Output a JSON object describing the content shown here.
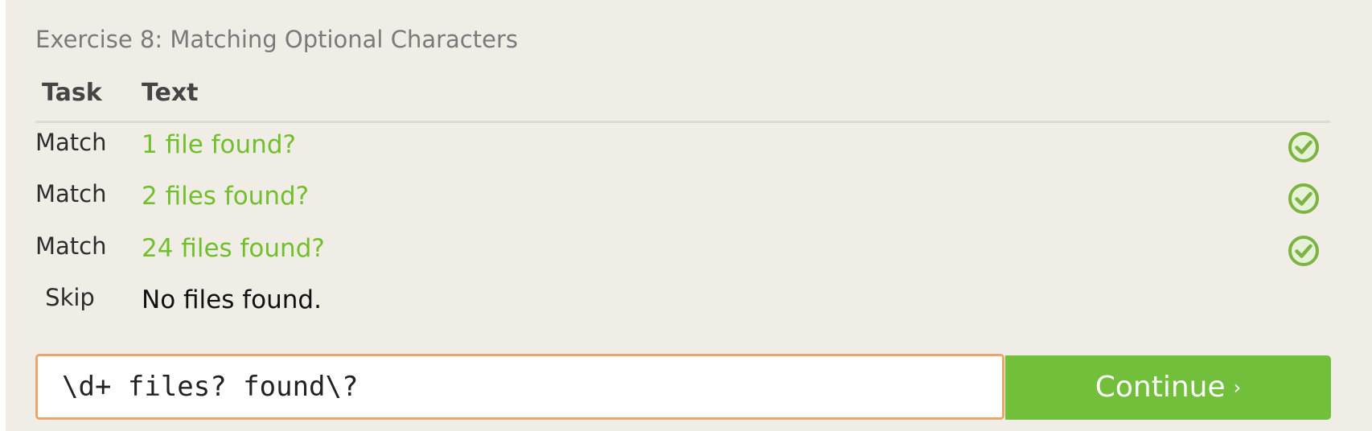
{
  "exercise": {
    "title": "Exercise 8: Matching Optional Characters"
  },
  "table": {
    "headers": {
      "task": "Task",
      "text": "Text"
    },
    "rows": [
      {
        "task": "Match",
        "text": "1 file found?",
        "status": "check-icon"
      },
      {
        "task": "Match",
        "text": "2 files found?",
        "status": "check-icon"
      },
      {
        "task": "Match",
        "text": "24 files found?",
        "status": "check-icon"
      },
      {
        "task": "Skip",
        "text": "No files found.",
        "status": ""
      }
    ]
  },
  "answer": {
    "value": "\\d+ files? found\\?"
  },
  "continue_button": {
    "label": "Continue",
    "arrow": "›"
  },
  "colors": {
    "background": "#efede6",
    "match_text": "#72bf2c",
    "button": "#72bf3c",
    "input_border": "#e8a66b"
  }
}
